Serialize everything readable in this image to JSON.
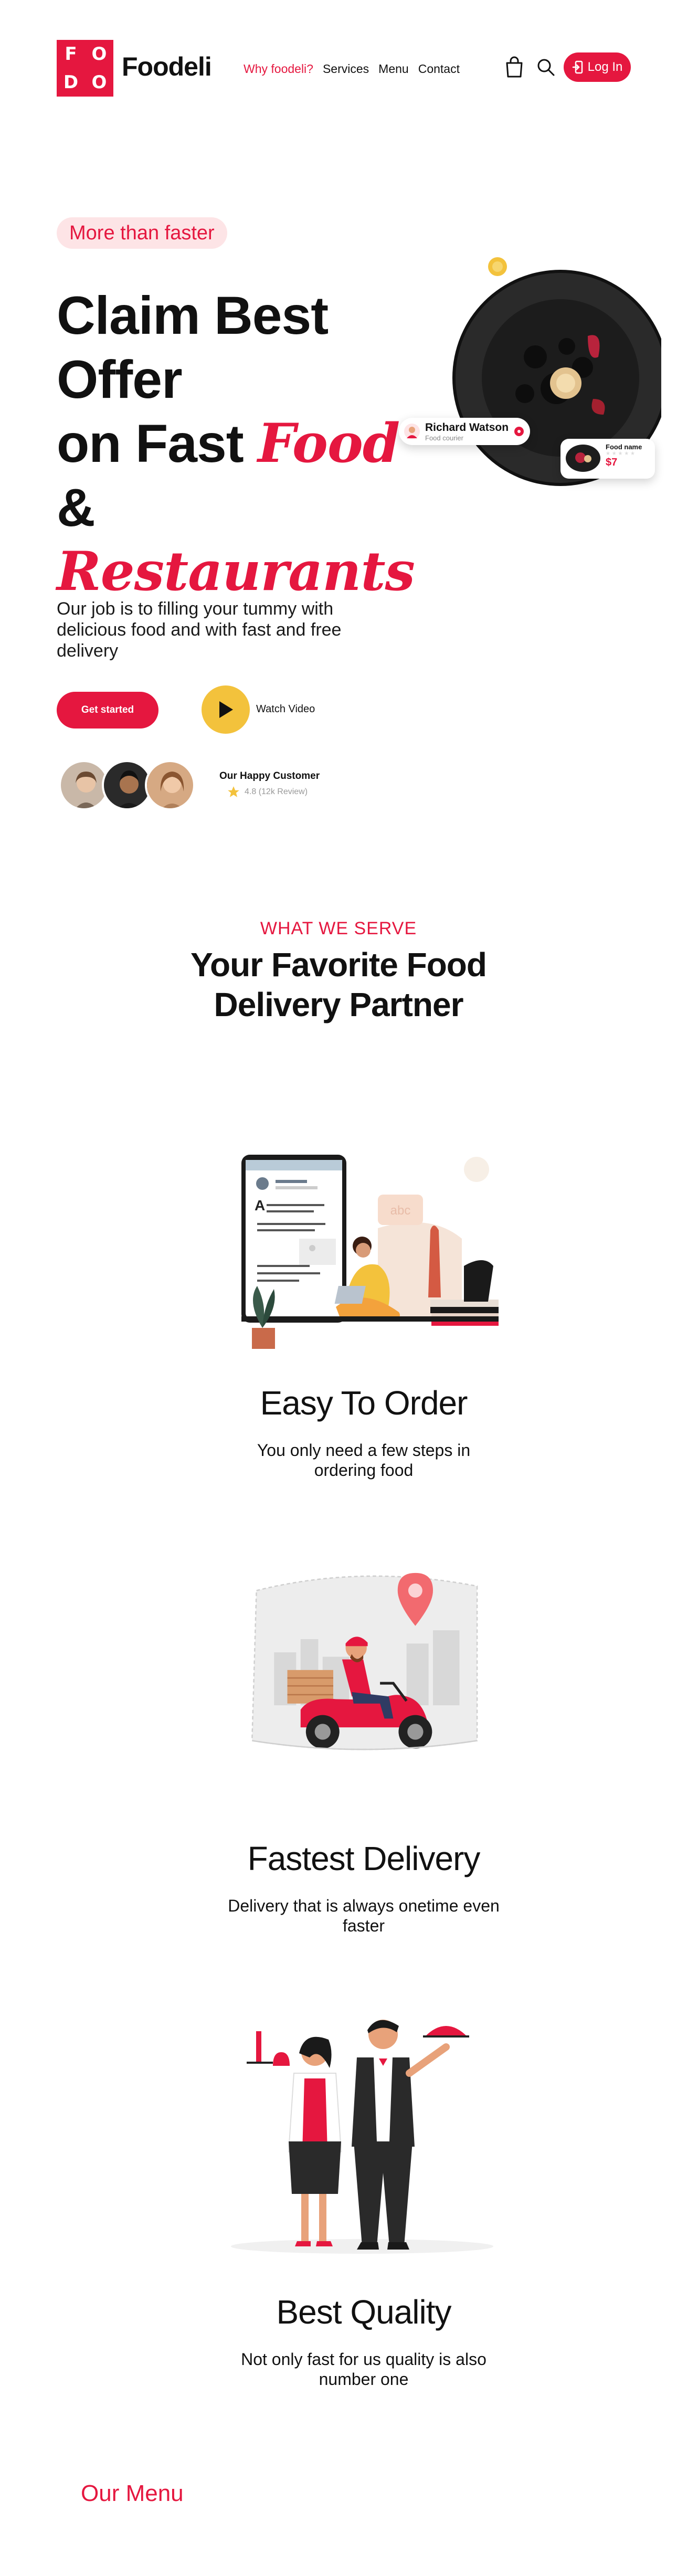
{
  "nav": {
    "logo_letters": [
      "F",
      "O",
      "D",
      "O"
    ],
    "brand": "Foodeli",
    "links": [
      "Why foodeli?",
      "Services",
      "Menu",
      "Contact"
    ],
    "login": "Log In"
  },
  "hero": {
    "pill": "More than faster",
    "title_line1": "Claim Best",
    "title_line2": "Offer",
    "title_line3_a": "on Fast ",
    "title_line3_b": "Food",
    "title_line3_c": " &",
    "title_line4": "Restaurants",
    "description": "Our job is to filling your tummy with delicious food and with fast and free delivery",
    "cta": "Get started",
    "watch": "Watch Video",
    "happy": "Our Happy Customer",
    "rating": "4.8 (12k Review)",
    "card_name": "Richard Watson",
    "card_role": "Food courier",
    "food_card_name": "Food name",
    "food_card_price": "$7"
  },
  "serve": {
    "eyebrow": "WHAT WE SERVE",
    "title": "Your Favorite Food Delivery Partner"
  },
  "features": [
    {
      "title": "Easy To Order",
      "desc": "You only need a few steps in ordering food"
    },
    {
      "title": "Fastest Delivery",
      "desc": "Delivery that is always onetime even faster"
    },
    {
      "title": "Best Quality",
      "desc": "Not only fast for us quality is also number one"
    }
  ],
  "illus_text": "abc",
  "menu": {
    "title": "Our Menu"
  },
  "colors": {
    "accent": "#e5173f",
    "yellow": "#f3c23c",
    "pill_bg": "#fde4e6"
  }
}
